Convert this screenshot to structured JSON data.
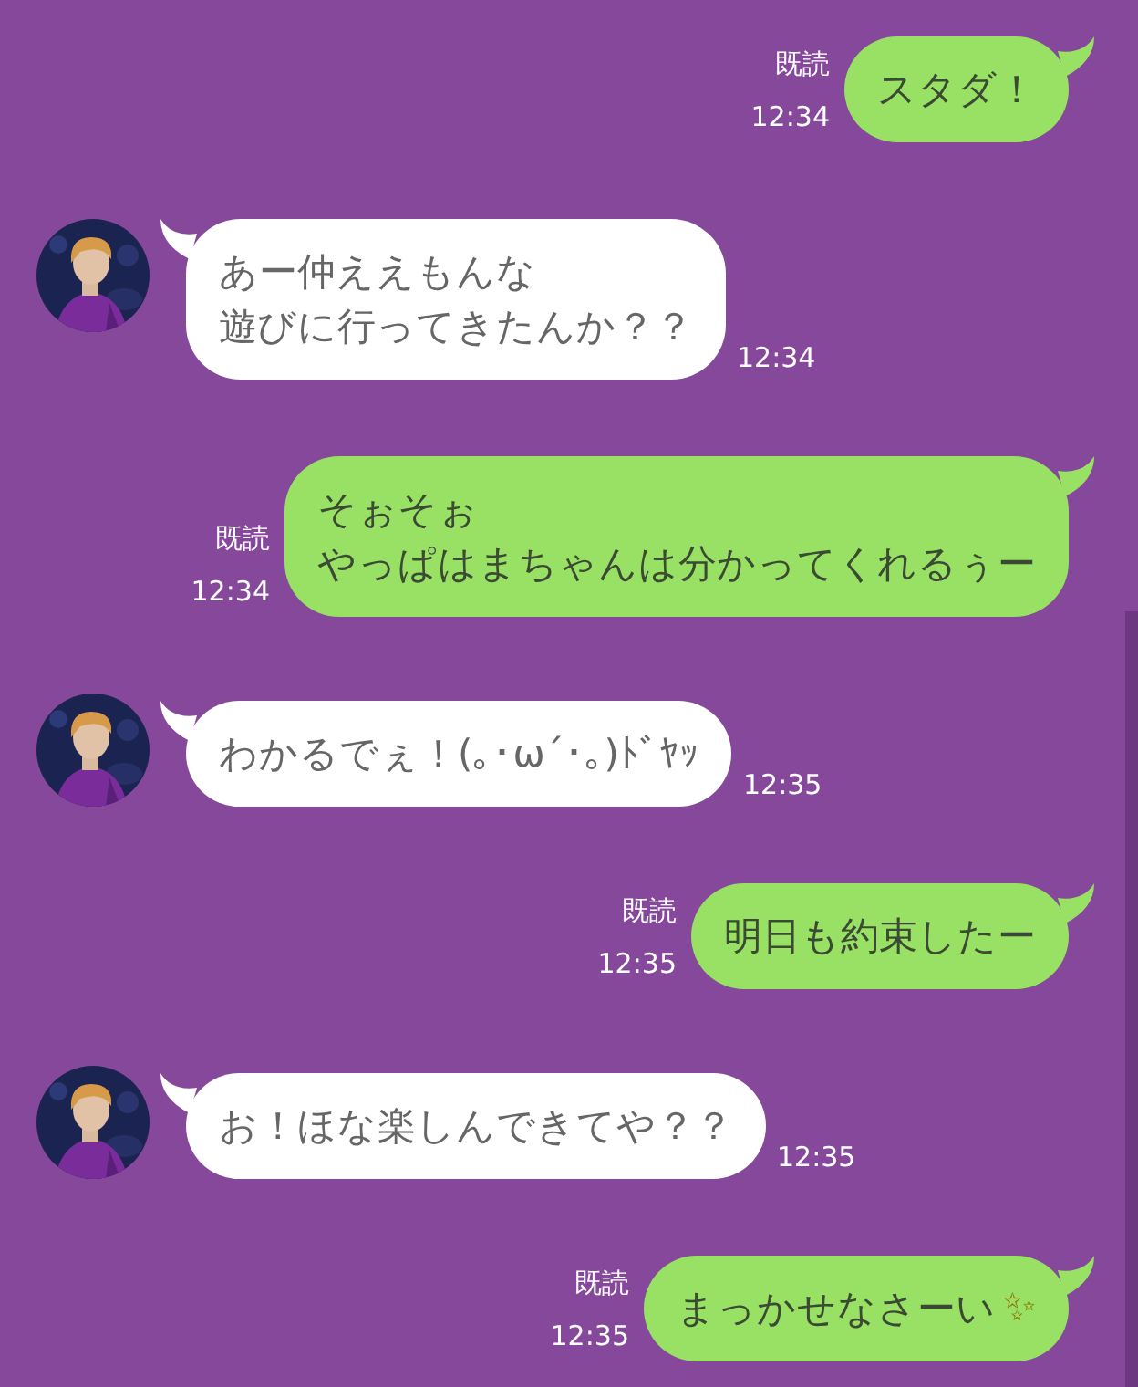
{
  "messages": [
    {
      "kind": "sent",
      "lines": [
        "スタダ！"
      ],
      "read_label": "既読",
      "time": "12:34"
    },
    {
      "kind": "received",
      "lines": [
        "あー仲ええもんな",
        "遊びに行ってきたんか？？"
      ],
      "time": "12:34"
    },
    {
      "kind": "sent",
      "lines": [
        "そぉそぉ",
        "やっぱはまちゃんは分かってくれるぅー"
      ],
      "read_label": "既読",
      "time": "12:34"
    },
    {
      "kind": "received",
      "lines": [
        "わかるでぇ！(｡･ω´･｡)ﾄﾞﾔｯ"
      ],
      "time": "12:35"
    },
    {
      "kind": "sent",
      "lines": [
        "明日も約束したー"
      ],
      "read_label": "既読",
      "time": "12:35"
    },
    {
      "kind": "received",
      "lines": [
        "お！ほな楽しんできてや？？"
      ],
      "time": "12:35"
    },
    {
      "kind": "sent",
      "lines": [
        "まっかせなさーい"
      ],
      "emoji": "✨",
      "read_label": "既読",
      "time": "12:35"
    }
  ]
}
